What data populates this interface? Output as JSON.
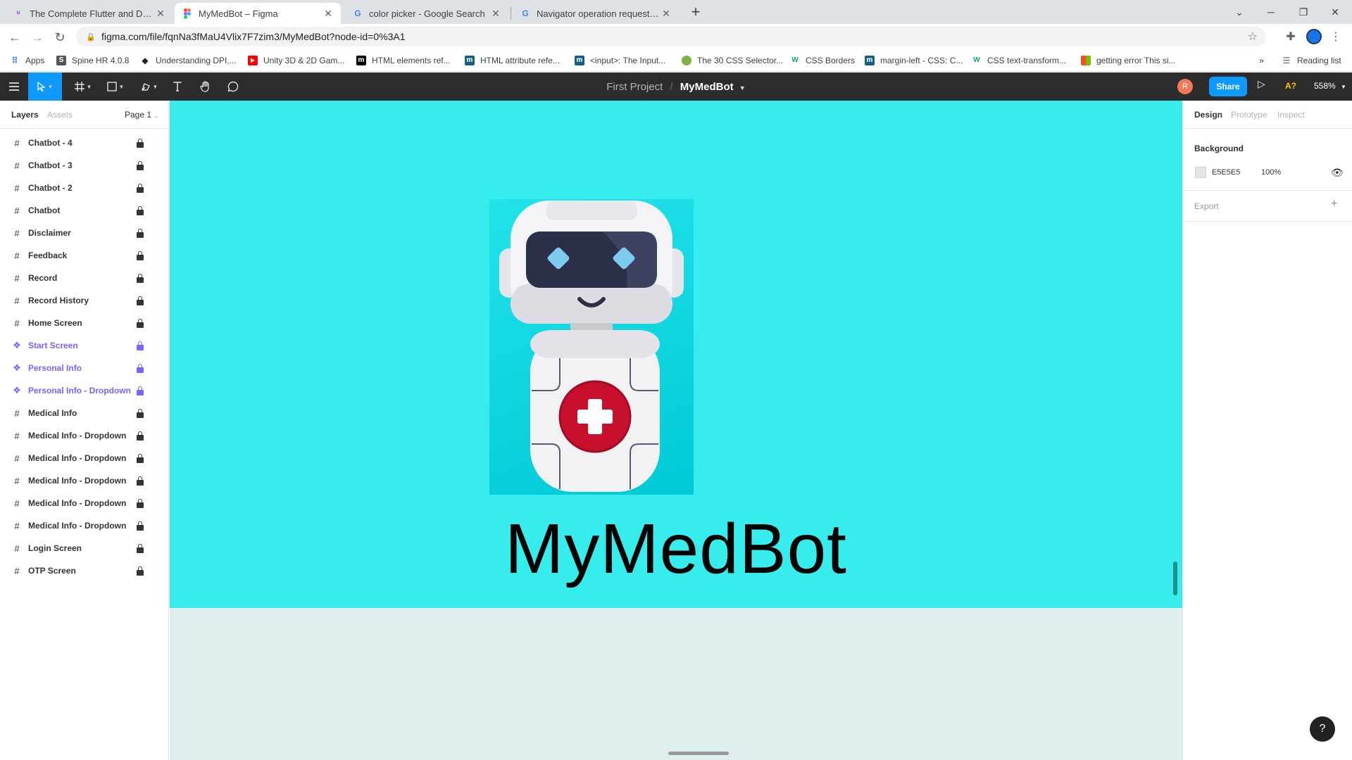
{
  "browser": {
    "tabs": [
      {
        "title": "The Complete Flutter and Dart G",
        "icon": "udemy-icon"
      },
      {
        "title": "MyMedBot – Figma",
        "icon": "figma-icon"
      },
      {
        "title": "color picker - Google Search",
        "icon": "google-icon"
      },
      {
        "title": "Navigator operation requested w",
        "icon": "google-icon"
      }
    ],
    "url": "figma.com/file/fqnNa3fMaU4Vlix7F7zim3/MyMedBot?node-id=0%3A1",
    "bookmarks": [
      {
        "label": "Apps",
        "icon": "apps-grid-icon",
        "color": "#4285f4"
      },
      {
        "label": "Spine HR 4.0.8",
        "icon": "spine-icon",
        "color": "#555555"
      },
      {
        "label": "Understanding DPI,...",
        "icon": "diamond-icon",
        "color": "#202124"
      },
      {
        "label": "Unity 3D & 2D Gam...",
        "icon": "youtube-icon",
        "color": "#ff0000"
      },
      {
        "label": "HTML elements ref...",
        "icon": "mdn-icon",
        "color": "#000000"
      },
      {
        "label": "HTML attribute refe...",
        "icon": "mdn-icon",
        "color": "#15607a"
      },
      {
        "label": "<input>: The Input...",
        "icon": "mdn-icon",
        "color": "#15607a"
      },
      {
        "label": "The 30 CSS Selector...",
        "icon": "leaf-icon",
        "color": "#7cb342"
      },
      {
        "label": "CSS Borders",
        "icon": "w3schools-icon",
        "color": "#04aa6d"
      },
      {
        "label": "margin-left - CSS: C...",
        "icon": "mdn-icon",
        "color": "#15607a"
      },
      {
        "label": "CSS text-transform...",
        "icon": "w3schools-icon",
        "color": "#04aa6d"
      },
      {
        "label": "getting error This si...",
        "icon": "microsoft-icon",
        "color": "#f25022"
      }
    ],
    "reading_list": "Reading list"
  },
  "figma": {
    "project": "First Project",
    "separator": "/",
    "file": "MyMedBot",
    "avatar_initial": "R",
    "share_label": "Share",
    "a11y_label": "A?",
    "zoom": "558%",
    "left_tabs": {
      "layers": "Layers",
      "assets": "Assets",
      "page": "Page 1"
    },
    "layers": [
      {
        "name": "Chatbot - 4",
        "type": "frame"
      },
      {
        "name": "Chatbot - 3",
        "type": "frame"
      },
      {
        "name": "Chatbot - 2",
        "type": "frame"
      },
      {
        "name": "Chatbot",
        "type": "frame"
      },
      {
        "name": "Disclaimer",
        "type": "frame"
      },
      {
        "name": "Feedback",
        "type": "frame"
      },
      {
        "name": "Record",
        "type": "frame"
      },
      {
        "name": "Record History",
        "type": "frame"
      },
      {
        "name": "Home Screen",
        "type": "frame"
      },
      {
        "name": "Start Screen",
        "type": "component"
      },
      {
        "name": "Personal Info",
        "type": "component"
      },
      {
        "name": "Personal Info - Dropdown",
        "type": "component"
      },
      {
        "name": "Medical Info",
        "type": "frame"
      },
      {
        "name": "Medical Info - Dropdown",
        "type": "frame"
      },
      {
        "name": "Medical Info - Dropdown",
        "type": "frame"
      },
      {
        "name": "Medical Info - Dropdown",
        "type": "frame"
      },
      {
        "name": "Medical Info - Dropdown",
        "type": "frame"
      },
      {
        "name": "Medical Info - Dropdown",
        "type": "frame"
      },
      {
        "name": "Login Screen",
        "type": "frame"
      },
      {
        "name": "OTP Screen",
        "type": "frame"
      }
    ],
    "canvas": {
      "frame_color": "#37ecec",
      "title": "MyMedBot"
    },
    "right_panel": {
      "tabs": [
        "Design",
        "Prototype",
        "Inspect"
      ],
      "background_label": "Background",
      "background_hex": "E5E5E5",
      "background_opacity": "100%",
      "export_label": "Export"
    },
    "help": "?"
  }
}
